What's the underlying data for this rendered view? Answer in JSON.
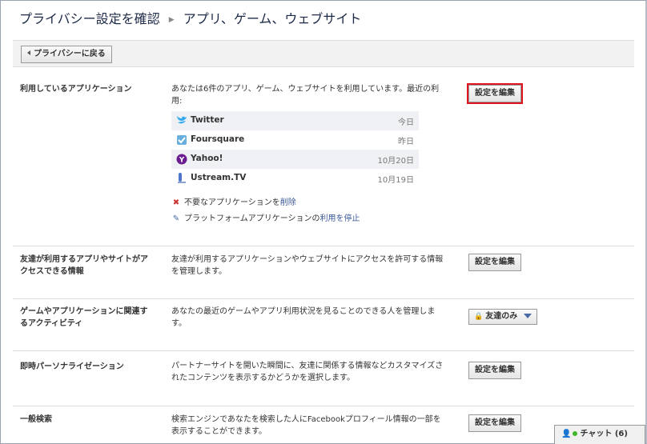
{
  "header": {
    "crumb_root": "プライバシー設定を確認",
    "crumb_sep": "▶",
    "crumb_current": "アプリ、ゲーム、ウェブサイト"
  },
  "toolbar": {
    "back_label": "プライバシーに戻る"
  },
  "sections": {
    "apps": {
      "title": "利用しているアプリケーション",
      "desc": "あなたは6件のアプリ、ゲーム、ウェブサイトを利用しています。最近の利用:",
      "button": "設定を編集",
      "apps": [
        {
          "name": "Twitter",
          "date": "今日",
          "icon": "twitter-icon"
        },
        {
          "name": "Foursquare",
          "date": "昨日",
          "icon": "foursquare-icon"
        },
        {
          "name": "Yahoo!",
          "date": "10月20日",
          "icon": "yahoo-icon"
        },
        {
          "name": "Ustream.TV",
          "date": "10月19日",
          "icon": "ustream-icon"
        }
      ],
      "remove_prefix": "不要なアプリケーションを",
      "remove_link": "削除",
      "stop_prefix": "プラットフォームアプリケーションの",
      "stop_link": "利用を停止"
    },
    "friends_apps": {
      "title": "友達が利用するアプリやサイトがアクセスできる情報",
      "desc": "友達が利用するアプリケーションやウェブサイトにアクセスを許可する情報を管理します。",
      "button": "設定を編集"
    },
    "game_activity": {
      "title": "ゲームやアプリケーションに関連するアクティビティ",
      "desc": "あなたの最近のゲームやアプリ利用状況を見ることのできる人を管理します。",
      "privacy_value": "友達のみ"
    },
    "instant_personalization": {
      "title": "即時パーソナライゼーション",
      "desc": "パートナーサイトを開いた瞬間に、友達に関係する情報などカスタマイズされたコンテンツを表示するかどうかを選択します。",
      "button": "設定を編集"
    },
    "public_search": {
      "title": "一般検索",
      "desc": "検索エンジンであなたを検索した人にFacebookプロフィール情報の一部を表示することができます。",
      "button": "設定を編集"
    }
  },
  "chat": {
    "label": "チャット (6)"
  },
  "colors": {
    "link": "#3b5998",
    "highlight": "#e0141e",
    "accent": "#4a6aa5"
  }
}
